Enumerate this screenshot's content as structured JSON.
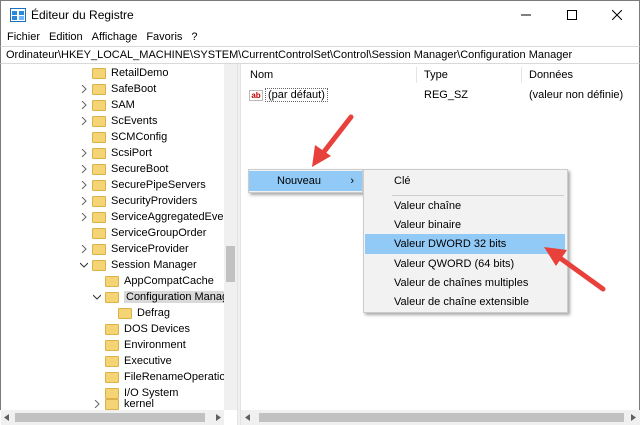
{
  "window": {
    "title": "Éditeur du Registre"
  },
  "menubar": {
    "items": [
      "Fichier",
      "Edition",
      "Affichage",
      "Favoris",
      "?"
    ]
  },
  "address": "Ordinateur\\HKEY_LOCAL_MACHINE\\SYSTEM\\CurrentControlSet\\Control\\Session Manager\\Configuration Manager",
  "tree": {
    "items": [
      {
        "label": "RetailDemo"
      },
      {
        "label": "SafeBoot"
      },
      {
        "label": "SAM"
      },
      {
        "label": "ScEvents"
      },
      {
        "label": "SCMConfig"
      },
      {
        "label": "ScsiPort"
      },
      {
        "label": "SecureBoot"
      },
      {
        "label": "SecurePipeServers"
      },
      {
        "label": "SecurityProviders"
      },
      {
        "label": "ServiceAggregatedEvents"
      },
      {
        "label": "ServiceGroupOrder"
      },
      {
        "label": "ServiceProvider"
      },
      {
        "label": "Session Manager"
      },
      {
        "label": "AppCompatCache"
      },
      {
        "label": "Configuration Manage"
      },
      {
        "label": "Defrag"
      },
      {
        "label": "DOS Devices"
      },
      {
        "label": "Environment"
      },
      {
        "label": "Executive"
      },
      {
        "label": "FileRenameOperations"
      },
      {
        "label": "I/O System"
      },
      {
        "label": "kernel"
      }
    ]
  },
  "list": {
    "columns": [
      "Nom",
      "Type",
      "Données"
    ],
    "rows": [
      {
        "name": "(par défaut)",
        "type": "REG_SZ",
        "data": "(valeur non définie)",
        "icon": "string-value-icon"
      }
    ]
  },
  "context_menu": {
    "nouveau": "Nouveau",
    "nouveau_arrow": "›"
  },
  "submenu": {
    "items": [
      "Clé",
      "Valeur chaîne",
      "Valeur binaire",
      "Valeur DWORD 32 bits",
      "Valeur QWORD (64 bits)",
      "Valeur de chaînes multiples",
      "Valeur de chaîne extensible"
    ],
    "highlighted": "Valeur DWORD 32 bits"
  },
  "colors": {
    "highlight": "#91c9f7",
    "annotation_arrow": "#e8413b"
  }
}
